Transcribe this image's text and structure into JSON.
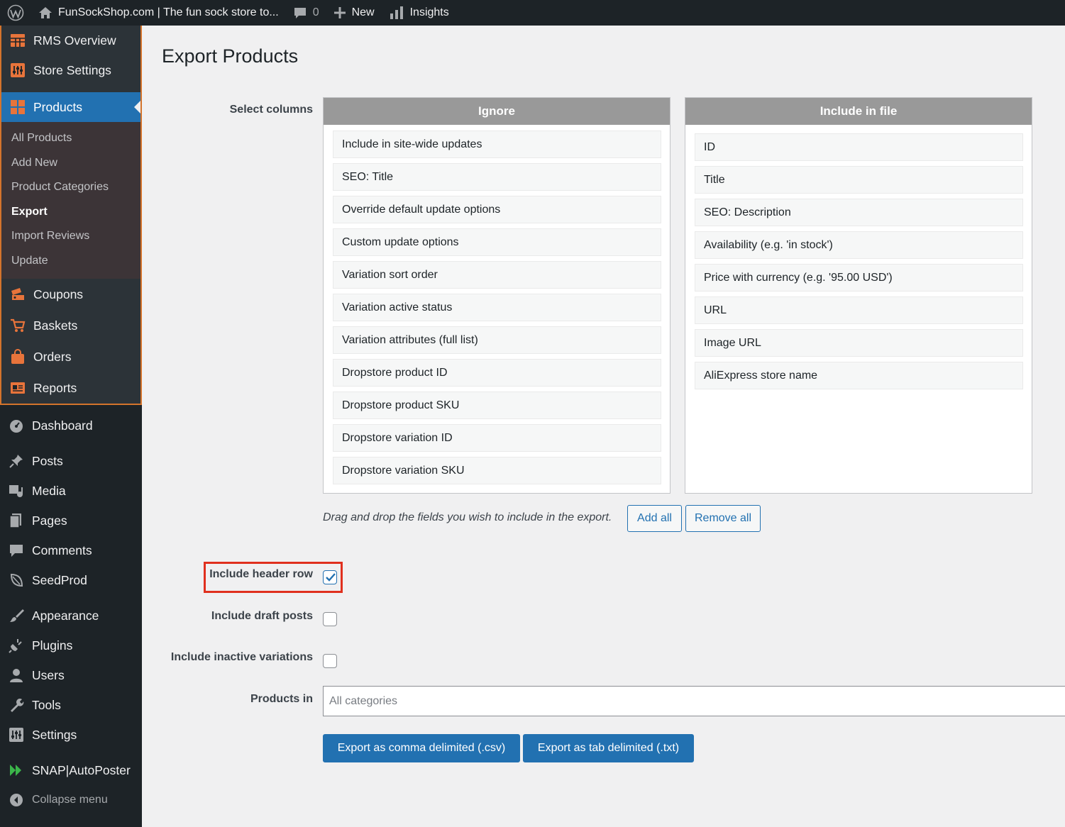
{
  "adminbar": {
    "site_name": "FunSockShop.com | The fun sock store to...",
    "comments_count": "0",
    "new_label": "New",
    "insights_label": "Insights"
  },
  "sidebar": {
    "rms": [
      {
        "label": "RMS Overview",
        "icon": "table-icon"
      },
      {
        "label": "Store Settings",
        "icon": "sliders-icon"
      }
    ],
    "products": {
      "label": "Products",
      "submenu": [
        "All Products",
        "Add New",
        "Product Categories",
        "Export",
        "Import Reviews",
        "Update"
      ],
      "current": "Export"
    },
    "store_items": [
      {
        "label": "Coupons"
      },
      {
        "label": "Baskets"
      },
      {
        "label": "Orders"
      },
      {
        "label": "Reports"
      }
    ],
    "dashboard": "Dashboard",
    "content_items": [
      "Posts",
      "Media",
      "Pages",
      "Comments",
      "SeedProd"
    ],
    "admin_items": [
      "Appearance",
      "Plugins",
      "Users",
      "Tools",
      "Settings"
    ],
    "snap": "SNAP|AutoPoster",
    "collapse": "Collapse menu",
    "accent_color": "#2271b1",
    "rms_border_color": "#d4742c"
  },
  "main": {
    "title": "Export Products",
    "select_columns_label": "Select columns",
    "ignore": {
      "header": "Ignore",
      "items": [
        "Include in site-wide updates",
        "SEO: Title",
        "Override default update options",
        "Custom update options",
        "Variation sort order",
        "Variation active status",
        "Variation attributes (full list)",
        "Dropstore product ID",
        "Dropstore product SKU",
        "Dropstore variation ID",
        "Dropstore variation SKU"
      ]
    },
    "include": {
      "header": "Include in file",
      "items": [
        "ID",
        "Title",
        "SEO: Description",
        "Availability (e.g. 'in stock')",
        "Price with currency (e.g. '95.00 USD')",
        "URL",
        "Image URL",
        "AliExpress store name"
      ]
    },
    "drag_hint": "Drag and drop the fields you wish to include in the export.",
    "add_all": "Add all",
    "remove_all": "Remove all",
    "options": {
      "header_row": {
        "label": "Include header row",
        "checked": true
      },
      "draft_posts": {
        "label": "Include draft posts",
        "checked": false
      },
      "inactive_variations": {
        "label": "Include inactive variations",
        "checked": false
      }
    },
    "products_in_label": "Products in",
    "products_in_placeholder": "All categories",
    "export_csv": "Export as comma delimited (.csv)",
    "export_txt": "Export as tab delimited (.txt)"
  }
}
